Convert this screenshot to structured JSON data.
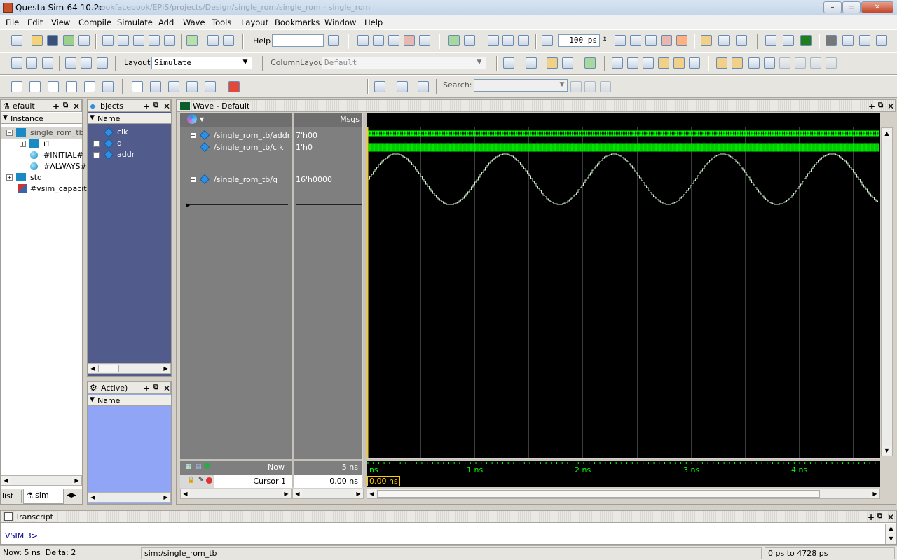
{
  "window": {
    "title": "Questa Sim-64 10.2c",
    "path_blurred": "- rookfacebook/EPIS/projects/Design/single_rom/single_rom - single_rom"
  },
  "menu": [
    "File",
    "Edit",
    "View",
    "Compile",
    "Simulate",
    "Add",
    "Wave",
    "Tools",
    "Layout",
    "Bookmarks",
    "Window",
    "Help"
  ],
  "toolbar": {
    "help_label": "Help",
    "run_length": "100",
    "run_unit": "ps",
    "layout_label": "Layout",
    "layout_value": "Simulate",
    "column_layout_label": "ColumnLayout",
    "column_layout_value": "Default",
    "search_label": "Search:"
  },
  "instance_pane": {
    "title": "efault",
    "column": "Instance",
    "items": [
      "single_rom_tb",
      "i1",
      "#INITIAL#",
      "#ALWAYS#",
      "std",
      "#vsim_capacity"
    ],
    "tabs": [
      "list",
      "sim"
    ]
  },
  "objects_pane": {
    "title": "bjects",
    "column": "Name",
    "items": [
      "clk",
      "q",
      "addr"
    ]
  },
  "processes_pane": {
    "title": "Active)",
    "column": "Name"
  },
  "wave": {
    "title": "Wave - Default",
    "msgs_label": "Msgs",
    "signals": [
      {
        "name": "/single_rom_tb/addr",
        "value": "7'h00"
      },
      {
        "name": "/single_rom_tb/clk",
        "value": "1'h0"
      },
      {
        "name": "/single_rom_tb/q",
        "value": "16'h0000"
      }
    ],
    "now_label": "Now",
    "now_value": "5 ns",
    "cursor_label": "Cursor 1",
    "cursor_value": "0.00 ns",
    "cursor_marker": "0.00 ns",
    "time_ticks": [
      "ns",
      "1 ns",
      "2 ns",
      "3 ns",
      "4 ns"
    ]
  },
  "transcript": {
    "title": "Transcript",
    "prompt": "VSIM 3>"
  },
  "status": {
    "now": "Now: 5 ns",
    "delta": "Delta: 2",
    "scope": "sim:/single_rom_tb",
    "range": "0 ps to 4728 ps"
  },
  "colors": {
    "wave_green": "#00ff00",
    "wave_analog": "#cfeecf",
    "cursor": "#ffcc00",
    "grid": "#3c3c3c"
  }
}
